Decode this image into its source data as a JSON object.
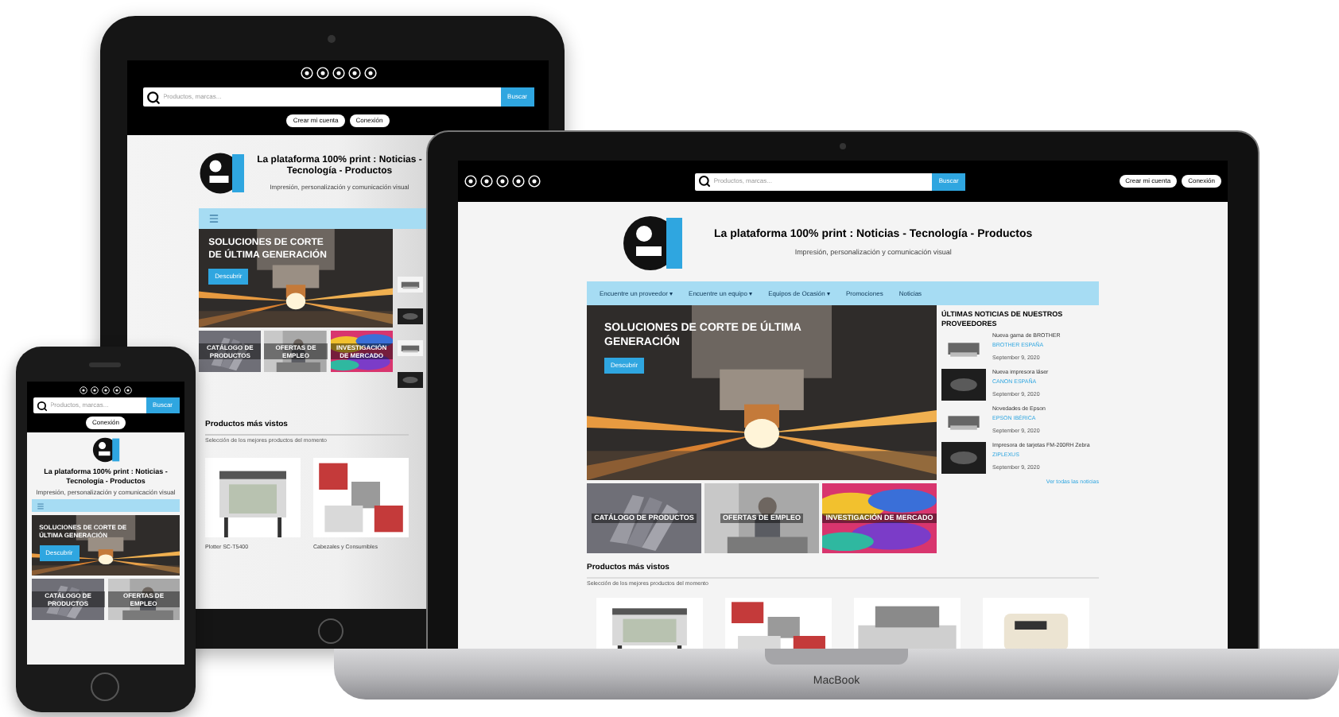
{
  "tablet": {
    "site": {
      "search": {
        "placeholder": "Productos, marcas...",
        "button": "Buscar"
      },
      "account_buttons": [
        "Crear mi cuenta",
        "Conexión"
      ],
      "title": "La plataforma 100% print : Noticias - Tecnología - Productos",
      "subtitle": "Impresión, personalización y comunicación visual",
      "hero": {
        "title": "SOLUCIONES DE CORTE DE ÚLTIMA GENERACIÓN",
        "button": "Descubrir"
      },
      "news": {
        "items": [
          {
            "kind": "picture"
          },
          {
            "kind": "picture"
          },
          {
            "kind": "picture"
          },
          {
            "kind": "picture"
          }
        ]
      },
      "tiles": [
        "CATÁLOGO DE PRODUCTOS",
        "OFERTAS DE EMPLEO",
        "INVESTIGACIÓN DE MERCADO"
      ],
      "products": {
        "heading": "Productos más vistos",
        "subheading": "Selección de los mejores productos del momento",
        "items": [
          {
            "kind": "picture",
            "caption": "Plotter SC-T5400"
          },
          {
            "kind": "picture",
            "caption": "Cabezales y Consumibles"
          }
        ]
      }
    }
  },
  "phone": {
    "site": {
      "search": {
        "placeholder": "Productos, marcas...",
        "button": "Buscar"
      },
      "account_buttons": [
        "Conexión"
      ],
      "title": "La plataforma 100% print : Noticias - Tecnología - Productos",
      "subtitle": "Impresión, personalización y comunicación visual",
      "hero": {
        "title": "SOLUCIONES DE CORTE DE ÚLTIMA GENERACIÓN",
        "button": "Descubrir"
      },
      "tiles": [
        "CATÁLOGO DE PRODUCTOS",
        "OFERTAS DE EMPLEO"
      ]
    }
  },
  "laptop": {
    "brand": "MacBook",
    "site": {
      "search": {
        "placeholder": "Productos, marcas...",
        "button": "Buscar"
      },
      "account_buttons": [
        "Crear mi cuenta",
        "Conexión"
      ],
      "title": "La plataforma 100% print : Noticias - Tecnología - Productos",
      "subtitle": "Impresión, personalización y comunicación visual",
      "nav": [
        "Encuentre un proveedor ▾",
        "Encuentre un equipo ▾",
        "Equipos de Ocasión ▾",
        "Promociones",
        "Noticias"
      ],
      "hero": {
        "title": "SOLUCIONES DE CORTE DE ÚLTIMA GENERACIÓN",
        "button": "Descubrir"
      },
      "news": {
        "heading": "ÚLTIMAS NOTICIAS DE NUESTROS PROVEEDORES",
        "more": "Ver todas las noticias",
        "items": [
          {
            "kind": "picture",
            "title": "Nueva gama de BROTHER",
            "source": "BROTHER ESPAÑA",
            "date": "September 9, 2020"
          },
          {
            "kind": "picture",
            "title": "Nueva impresora láser",
            "source": "CANON ESPAÑA",
            "date": "September 9, 2020"
          },
          {
            "kind": "picture",
            "title": "Novedades de Epson",
            "source": "EPSON IBÉRICA",
            "date": "September 9, 2020"
          },
          {
            "kind": "picture",
            "title": "Impresora de tarjetas FM-200RH Zebra",
            "source": "ZIPLEXUS",
            "date": "September 9, 2020"
          }
        ]
      },
      "tiles": [
        "CATÁLOGO DE PRODUCTOS",
        "OFERTAS DE EMPLEO",
        "INVESTIGACIÓN DE MERCADO"
      ],
      "products": {
        "heading": "Productos más vistos",
        "subheading": "Selección de los mejores productos del momento",
        "items": [
          {
            "kind": "picture"
          },
          {
            "kind": "picture"
          },
          {
            "kind": "picture"
          },
          {
            "kind": "picture"
          }
        ]
      }
    }
  }
}
